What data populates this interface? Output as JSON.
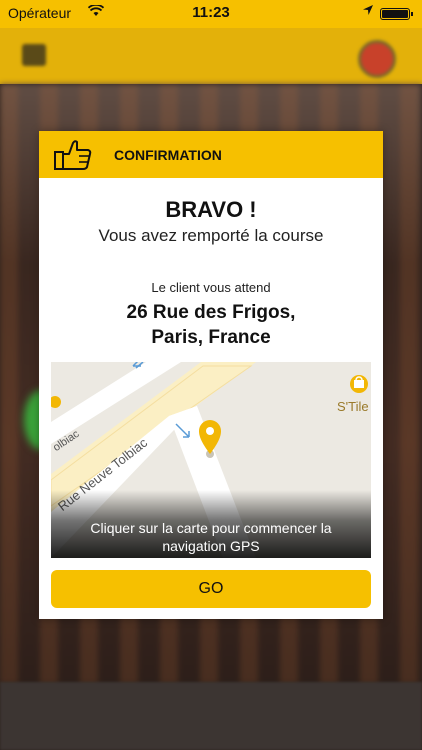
{
  "status_bar": {
    "carrier": "Opérateur",
    "time": "11:23",
    "wifi_icon": "wifi-icon",
    "location_icon": "location-arrow-icon",
    "battery_icon": "battery-icon"
  },
  "modal": {
    "header_icon": "thumbs-up-icon",
    "header_title": "CONFIRMATION",
    "title": "BRAVO !",
    "subtitle": "Vous avez remporté la course",
    "waiting_text": "Le client vous attend",
    "address_line1": "26 Rue des Frigos,",
    "address_line2": "Paris, France",
    "map": {
      "street_label": "Rue Neuve Tolbiac",
      "street_label_partial": "olbiac",
      "poi_label": "S'Tile",
      "pin_icon": "map-pin-icon",
      "caption": "Cliquer sur la carte pour commencer la navigation GPS"
    },
    "go_button": "GO"
  },
  "colors": {
    "brand_yellow": "#f6c000",
    "pin_yellow": "#f2b705",
    "map_background": "#ece9e2"
  }
}
